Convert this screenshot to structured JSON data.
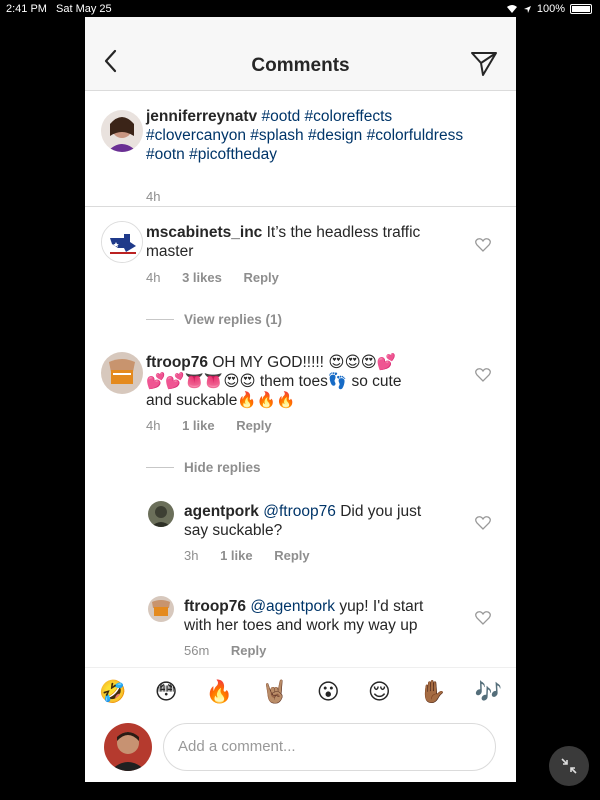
{
  "status": {
    "time": "2:41 PM",
    "date": "Sat May 25",
    "battery": "100%"
  },
  "header": {
    "title": "Comments"
  },
  "post": {
    "username": "jenniferreynatv",
    "line1": "#ootd #coloreffects",
    "line2": "#clovercanyon #splash #design #colorfuldress",
    "line3": "#ootn #picoftheday",
    "time": "4h"
  },
  "comments": [
    {
      "username": "mscabinets_inc",
      "text1": "It’s the headless traffic",
      "text2": "master",
      "time": "4h",
      "likes": "3 likes",
      "reply": "Reply",
      "replies_toggle": "View replies (1)"
    },
    {
      "username": "ftroop76",
      "text1": "OH MY GOD!!!!! 😍😍😍💕",
      "text2": "💕💕👅👅😍😍 them toes👣 so cute",
      "text3": "and suckable🔥🔥🔥",
      "time": "4h",
      "likes": "1 like",
      "reply": "Reply",
      "replies_toggle": "Hide replies",
      "replies": [
        {
          "username": "agentpork",
          "mention": "@ftroop76",
          "text1": "Did you just",
          "text2": "say suckable?",
          "time": "3h",
          "likes": "1 like",
          "reply": "Reply"
        },
        {
          "username": "ftroop76",
          "mention": "@agentpork",
          "text1": "yup! I'd start",
          "text2": "with her toes and work my way up",
          "time": "56m",
          "reply": "Reply"
        }
      ]
    }
  ],
  "emojis": [
    "🤣",
    "😳",
    "🔥",
    "🤘🏽",
    "😮",
    "😌",
    "✋🏾",
    "🎶"
  ],
  "composer": {
    "placeholder": "Add a comment..."
  }
}
